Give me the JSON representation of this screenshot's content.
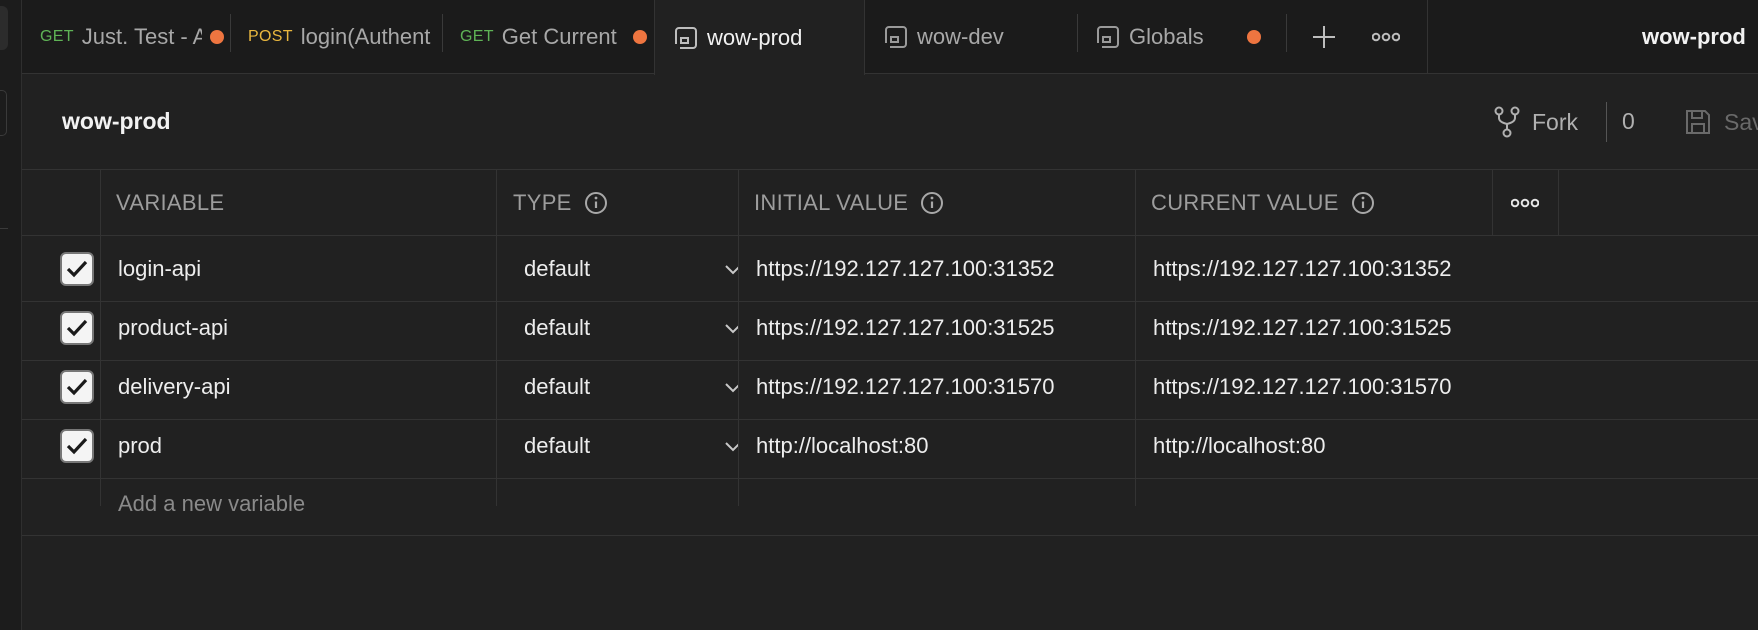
{
  "tabs": [
    {
      "method": "GET",
      "name": "Just. Test - Add",
      "unsaved": true
    },
    {
      "method": "POST",
      "name": "login(Authentication)",
      "unsaved": false
    },
    {
      "method": "GET",
      "name": "Get Current",
      "unsaved": true
    },
    {
      "method": "",
      "name": "wow-prod",
      "unsaved": false,
      "active": true
    },
    {
      "method": "",
      "name": "wow-dev",
      "unsaved": false
    },
    {
      "method": "",
      "name": "Globals",
      "unsaved": true
    }
  ],
  "tabbar": {
    "new_tab_icon": "plus-icon",
    "more_icon": "more-horizontal-icon",
    "active_environment": "wow-prod"
  },
  "header": {
    "title": "wow-prod",
    "fork_label": "Fork",
    "fork_count": "0",
    "save_label": "Save"
  },
  "table": {
    "columns": [
      "VARIABLE",
      "TYPE",
      "INITIAL VALUE",
      "CURRENT VALUE"
    ],
    "rows": [
      {
        "enabled": true,
        "variable": "login-api",
        "type": "default",
        "initial": "https://192.127.127.100:31352",
        "current": "https://192.127.127.100:31352"
      },
      {
        "enabled": true,
        "variable": "product-api",
        "type": "default",
        "initial": "https://192.127.127.100:31525",
        "current": "https://192.127.127.100:31525"
      },
      {
        "enabled": true,
        "variable": "delivery-api",
        "type": "default",
        "initial": "https://192.127.127.100:31570",
        "current": "https://192.127.127.100:31570"
      },
      {
        "enabled": true,
        "variable": "prod",
        "type": "default",
        "initial": "http://localhost:80",
        "current": "http://localhost:80"
      }
    ],
    "new_variable_placeholder": "Add a new variable"
  },
  "colors": {
    "get": "#5fb356",
    "post": "#e9b73e",
    "unsaved_dot": "#ee7540",
    "background": "#212121"
  }
}
